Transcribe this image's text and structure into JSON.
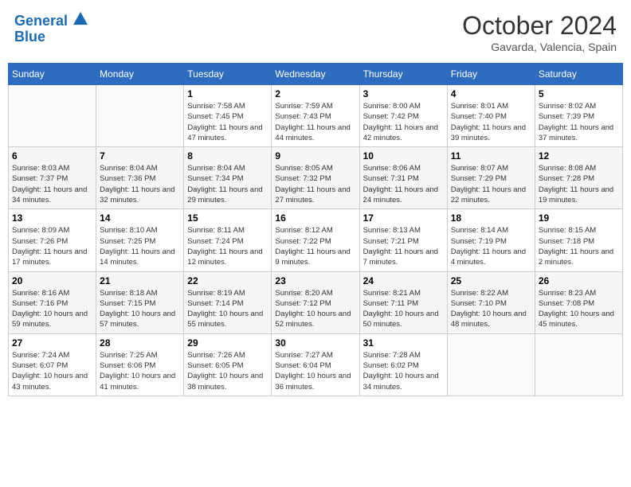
{
  "header": {
    "logo_line1": "General",
    "logo_line2": "Blue",
    "month_title": "October 2024",
    "subtitle": "Gavarda, Valencia, Spain"
  },
  "weekdays": [
    "Sunday",
    "Monday",
    "Tuesday",
    "Wednesday",
    "Thursday",
    "Friday",
    "Saturday"
  ],
  "weeks": [
    [
      {
        "day": "",
        "info": ""
      },
      {
        "day": "",
        "info": ""
      },
      {
        "day": "1",
        "info": "Sunrise: 7:58 AM\nSunset: 7:45 PM\nDaylight: 11 hours and 47 minutes."
      },
      {
        "day": "2",
        "info": "Sunrise: 7:59 AM\nSunset: 7:43 PM\nDaylight: 11 hours and 44 minutes."
      },
      {
        "day": "3",
        "info": "Sunrise: 8:00 AM\nSunset: 7:42 PM\nDaylight: 11 hours and 42 minutes."
      },
      {
        "day": "4",
        "info": "Sunrise: 8:01 AM\nSunset: 7:40 PM\nDaylight: 11 hours and 39 minutes."
      },
      {
        "day": "5",
        "info": "Sunrise: 8:02 AM\nSunset: 7:39 PM\nDaylight: 11 hours and 37 minutes."
      }
    ],
    [
      {
        "day": "6",
        "info": "Sunrise: 8:03 AM\nSunset: 7:37 PM\nDaylight: 11 hours and 34 minutes."
      },
      {
        "day": "7",
        "info": "Sunrise: 8:04 AM\nSunset: 7:36 PM\nDaylight: 11 hours and 32 minutes."
      },
      {
        "day": "8",
        "info": "Sunrise: 8:04 AM\nSunset: 7:34 PM\nDaylight: 11 hours and 29 minutes."
      },
      {
        "day": "9",
        "info": "Sunrise: 8:05 AM\nSunset: 7:32 PM\nDaylight: 11 hours and 27 minutes."
      },
      {
        "day": "10",
        "info": "Sunrise: 8:06 AM\nSunset: 7:31 PM\nDaylight: 11 hours and 24 minutes."
      },
      {
        "day": "11",
        "info": "Sunrise: 8:07 AM\nSunset: 7:29 PM\nDaylight: 11 hours and 22 minutes."
      },
      {
        "day": "12",
        "info": "Sunrise: 8:08 AM\nSunset: 7:28 PM\nDaylight: 11 hours and 19 minutes."
      }
    ],
    [
      {
        "day": "13",
        "info": "Sunrise: 8:09 AM\nSunset: 7:26 PM\nDaylight: 11 hours and 17 minutes."
      },
      {
        "day": "14",
        "info": "Sunrise: 8:10 AM\nSunset: 7:25 PM\nDaylight: 11 hours and 14 minutes."
      },
      {
        "day": "15",
        "info": "Sunrise: 8:11 AM\nSunset: 7:24 PM\nDaylight: 11 hours and 12 minutes."
      },
      {
        "day": "16",
        "info": "Sunrise: 8:12 AM\nSunset: 7:22 PM\nDaylight: 11 hours and 9 minutes."
      },
      {
        "day": "17",
        "info": "Sunrise: 8:13 AM\nSunset: 7:21 PM\nDaylight: 11 hours and 7 minutes."
      },
      {
        "day": "18",
        "info": "Sunrise: 8:14 AM\nSunset: 7:19 PM\nDaylight: 11 hours and 4 minutes."
      },
      {
        "day": "19",
        "info": "Sunrise: 8:15 AM\nSunset: 7:18 PM\nDaylight: 11 hours and 2 minutes."
      }
    ],
    [
      {
        "day": "20",
        "info": "Sunrise: 8:16 AM\nSunset: 7:16 PM\nDaylight: 10 hours and 59 minutes."
      },
      {
        "day": "21",
        "info": "Sunrise: 8:18 AM\nSunset: 7:15 PM\nDaylight: 10 hours and 57 minutes."
      },
      {
        "day": "22",
        "info": "Sunrise: 8:19 AM\nSunset: 7:14 PM\nDaylight: 10 hours and 55 minutes."
      },
      {
        "day": "23",
        "info": "Sunrise: 8:20 AM\nSunset: 7:12 PM\nDaylight: 10 hours and 52 minutes."
      },
      {
        "day": "24",
        "info": "Sunrise: 8:21 AM\nSunset: 7:11 PM\nDaylight: 10 hours and 50 minutes."
      },
      {
        "day": "25",
        "info": "Sunrise: 8:22 AM\nSunset: 7:10 PM\nDaylight: 10 hours and 48 minutes."
      },
      {
        "day": "26",
        "info": "Sunrise: 8:23 AM\nSunset: 7:08 PM\nDaylight: 10 hours and 45 minutes."
      }
    ],
    [
      {
        "day": "27",
        "info": "Sunrise: 7:24 AM\nSunset: 6:07 PM\nDaylight: 10 hours and 43 minutes."
      },
      {
        "day": "28",
        "info": "Sunrise: 7:25 AM\nSunset: 6:06 PM\nDaylight: 10 hours and 41 minutes."
      },
      {
        "day": "29",
        "info": "Sunrise: 7:26 AM\nSunset: 6:05 PM\nDaylight: 10 hours and 38 minutes."
      },
      {
        "day": "30",
        "info": "Sunrise: 7:27 AM\nSunset: 6:04 PM\nDaylight: 10 hours and 36 minutes."
      },
      {
        "day": "31",
        "info": "Sunrise: 7:28 AM\nSunset: 6:02 PM\nDaylight: 10 hours and 34 minutes."
      },
      {
        "day": "",
        "info": ""
      },
      {
        "day": "",
        "info": ""
      }
    ]
  ]
}
